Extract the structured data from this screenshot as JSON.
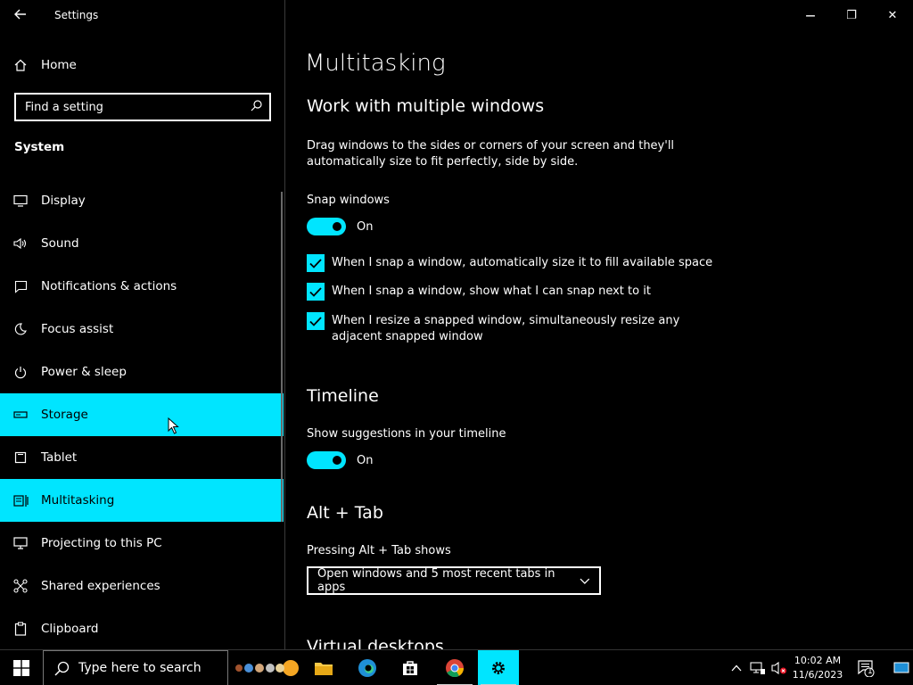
{
  "window": {
    "title": "Settings",
    "minimize_glyph": "—",
    "restore_glyph": "❐",
    "close_glyph": "✕"
  },
  "sidebar": {
    "home_label": "Home",
    "search_placeholder": "Find a setting",
    "section_label": "System",
    "items": [
      {
        "label": "Display",
        "icon": "display-icon"
      },
      {
        "label": "Sound",
        "icon": "sound-icon"
      },
      {
        "label": "Notifications & actions",
        "icon": "notifications-icon"
      },
      {
        "label": "Focus assist",
        "icon": "moon-icon"
      },
      {
        "label": "Power & sleep",
        "icon": "power-icon"
      },
      {
        "label": "Storage",
        "icon": "storage-icon",
        "state": "hover"
      },
      {
        "label": "Tablet",
        "icon": "tablet-icon"
      },
      {
        "label": "Multitasking",
        "icon": "multitasking-icon",
        "state": "selected"
      },
      {
        "label": "Projecting to this PC",
        "icon": "projecting-icon"
      },
      {
        "label": "Shared experiences",
        "icon": "shared-icon"
      },
      {
        "label": "Clipboard",
        "icon": "clipboard-icon"
      }
    ]
  },
  "main": {
    "page_title": "Multitasking",
    "windows": {
      "heading": "Work with multiple windows",
      "description": "Drag windows to the sides or corners of your screen and they'll automatically size to fit perfectly, side by side.",
      "snap_label": "Snap windows",
      "snap_state": "On",
      "options": [
        "When I snap a window, automatically size it to fill available space",
        "When I snap a window, show what I can snap next to it",
        "When I resize a snapped window, simultaneously resize any adjacent snapped window"
      ]
    },
    "timeline": {
      "heading": "Timeline",
      "label": "Show suggestions in your timeline",
      "state": "On"
    },
    "alttab": {
      "heading": "Alt + Tab",
      "label": "Pressing Alt + Tab shows",
      "value": "Open windows and 5 most recent tabs in apps"
    },
    "virtual_desktops_heading": "Virtual desktops"
  },
  "taskbar": {
    "search_placeholder": "Type here to search",
    "time": "10:02 AM",
    "date": "11/6/2023",
    "notification_count": "1"
  },
  "colors": {
    "accent": "#00e5ff",
    "background": "#000000",
    "text": "#ffffff"
  }
}
